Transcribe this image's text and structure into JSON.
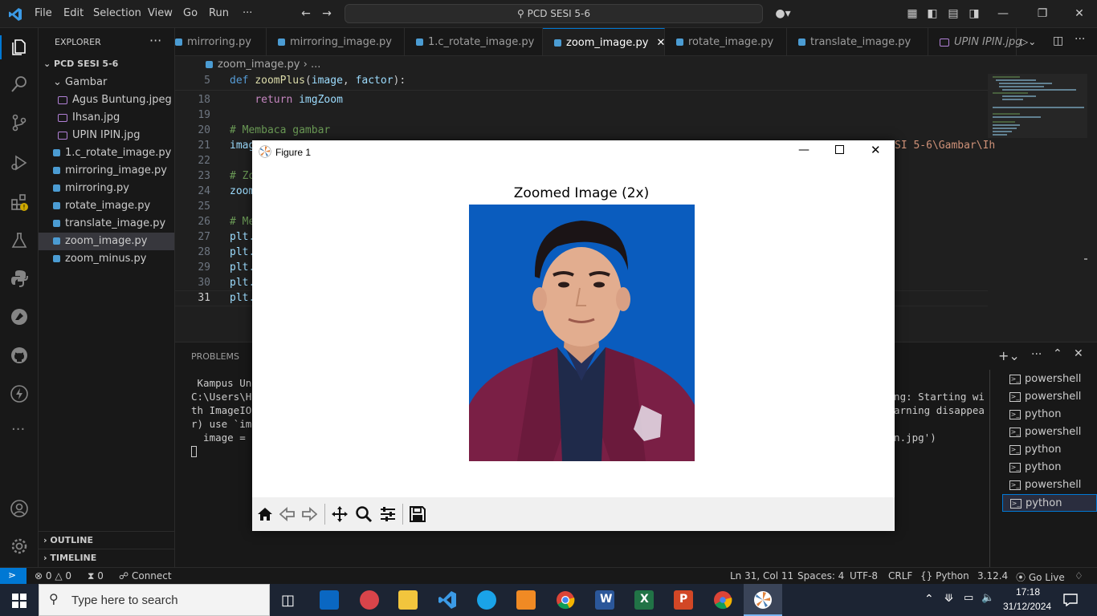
{
  "titlebar": {
    "menu": [
      "File",
      "Edit",
      "Selection",
      "View",
      "Go",
      "Run",
      "···"
    ],
    "search_text": "PCD SESI 5-6"
  },
  "sidebar": {
    "header": "EXPLORER",
    "folder": "PCD SESI 5-6",
    "subfolder": "Gambar",
    "files": [
      {
        "name": "Agus Buntung.jpeg",
        "type": "image"
      },
      {
        "name": "Ihsan.jpg",
        "type": "image"
      },
      {
        "name": "UPIN IPIN.jpg",
        "type": "image"
      },
      {
        "name": "1.c_rotate_image.py",
        "type": "py"
      },
      {
        "name": "mirroring_image.py",
        "type": "py"
      },
      {
        "name": "mirroring.py",
        "type": "py"
      },
      {
        "name": "rotate_image.py",
        "type": "py"
      },
      {
        "name": "translate_image.py",
        "type": "py"
      },
      {
        "name": "zoom_image.py",
        "type": "py"
      },
      {
        "name": "zoom_minus.py",
        "type": "py"
      }
    ],
    "outline": "OUTLINE",
    "timeline": "TIMELINE"
  },
  "tabs": [
    "mirroring.py",
    "mirroring_image.py",
    "1.c_rotate_image.py",
    "zoom_image.py",
    "rotate_image.py",
    "translate_image.py",
    "UPIN IPIN.jpg"
  ],
  "active_tab": "zoom_image.py",
  "breadcrumb": {
    "file": "zoom_image.py",
    "rest": "..."
  },
  "editor": {
    "sticky": {
      "ln": "5",
      "text": "def zoomPlus(image, factor):"
    },
    "lines": [
      {
        "ln": "18",
        "text": "    return imgZoom"
      },
      {
        "ln": "19",
        "text": ""
      },
      {
        "ln": "20",
        "text": "# Membaca gambar"
      },
      {
        "ln": "21",
        "text": "imag"
      },
      {
        "ln": "22",
        "text": ""
      },
      {
        "ln": "23",
        "text": "# Zo"
      },
      {
        "ln": "24",
        "text": "zoom"
      },
      {
        "ln": "25",
        "text": ""
      },
      {
        "ln": "26",
        "text": "# Me"
      },
      {
        "ln": "27",
        "text": "plt."
      },
      {
        "ln": "28",
        "text": "plt."
      },
      {
        "ln": "29",
        "text": "plt."
      },
      {
        "ln": "30",
        "text": "plt."
      },
      {
        "ln": "31",
        "text": "plt."
      }
    ],
    "line21_tail": "SI 5-6\\Gambar\\Ih"
  },
  "panel": {
    "tab": "PROBLEMS",
    "terminal_left": [
      " Kampus Uns",
      "C:\\Users\\HP",
      "th ImageIO ",
      "r) use `imp",
      "  image = i"
    ],
    "terminal_right": [
      "ning: Starting wi",
      " warning disappea",
      "san.jpg')"
    ],
    "terminals": [
      "powershell",
      "powershell",
      "python",
      "powershell",
      "python",
      "python",
      "powershell",
      "python"
    ]
  },
  "statusbar": {
    "errors": "0",
    "warnings": "0",
    "ports": "0",
    "connect": "Connect",
    "position": "Ln 31, Col 11",
    "spaces": "Spaces: 4",
    "encoding": "UTF-8",
    "eol": "CRLF",
    "language": "Python",
    "version": "3.12.4",
    "golive": "Go Live"
  },
  "figure": {
    "window_title": "Figure 1",
    "plot_title": "Zoomed Image (2x)"
  },
  "taskbar": {
    "search_placeholder": "Type here to search",
    "time": "17:18",
    "date": "31/12/2024"
  },
  "colors": {
    "accent": "#0078d4",
    "photo_bg": "#0b5ec0",
    "jacket": "#7a1f45"
  }
}
